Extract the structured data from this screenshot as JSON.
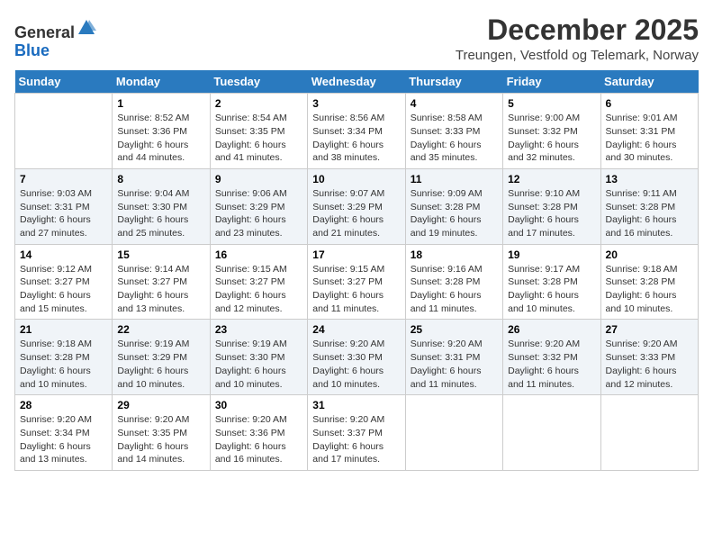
{
  "logo": {
    "general": "General",
    "blue": "Blue"
  },
  "title": "December 2025",
  "subtitle": "Treungen, Vestfold og Telemark, Norway",
  "weekdays": [
    "Sunday",
    "Monday",
    "Tuesday",
    "Wednesday",
    "Thursday",
    "Friday",
    "Saturday"
  ],
  "weeks": [
    [
      {
        "day": "",
        "info": ""
      },
      {
        "day": "1",
        "info": "Sunrise: 8:52 AM\nSunset: 3:36 PM\nDaylight: 6 hours\nand 44 minutes."
      },
      {
        "day": "2",
        "info": "Sunrise: 8:54 AM\nSunset: 3:35 PM\nDaylight: 6 hours\nand 41 minutes."
      },
      {
        "day": "3",
        "info": "Sunrise: 8:56 AM\nSunset: 3:34 PM\nDaylight: 6 hours\nand 38 minutes."
      },
      {
        "day": "4",
        "info": "Sunrise: 8:58 AM\nSunset: 3:33 PM\nDaylight: 6 hours\nand 35 minutes."
      },
      {
        "day": "5",
        "info": "Sunrise: 9:00 AM\nSunset: 3:32 PM\nDaylight: 6 hours\nand 32 minutes."
      },
      {
        "day": "6",
        "info": "Sunrise: 9:01 AM\nSunset: 3:31 PM\nDaylight: 6 hours\nand 30 minutes."
      }
    ],
    [
      {
        "day": "7",
        "info": "Sunrise: 9:03 AM\nSunset: 3:31 PM\nDaylight: 6 hours\nand 27 minutes."
      },
      {
        "day": "8",
        "info": "Sunrise: 9:04 AM\nSunset: 3:30 PM\nDaylight: 6 hours\nand 25 minutes."
      },
      {
        "day": "9",
        "info": "Sunrise: 9:06 AM\nSunset: 3:29 PM\nDaylight: 6 hours\nand 23 minutes."
      },
      {
        "day": "10",
        "info": "Sunrise: 9:07 AM\nSunset: 3:29 PM\nDaylight: 6 hours\nand 21 minutes."
      },
      {
        "day": "11",
        "info": "Sunrise: 9:09 AM\nSunset: 3:28 PM\nDaylight: 6 hours\nand 19 minutes."
      },
      {
        "day": "12",
        "info": "Sunrise: 9:10 AM\nSunset: 3:28 PM\nDaylight: 6 hours\nand 17 minutes."
      },
      {
        "day": "13",
        "info": "Sunrise: 9:11 AM\nSunset: 3:28 PM\nDaylight: 6 hours\nand 16 minutes."
      }
    ],
    [
      {
        "day": "14",
        "info": "Sunrise: 9:12 AM\nSunset: 3:27 PM\nDaylight: 6 hours\nand 15 minutes."
      },
      {
        "day": "15",
        "info": "Sunrise: 9:14 AM\nSunset: 3:27 PM\nDaylight: 6 hours\nand 13 minutes."
      },
      {
        "day": "16",
        "info": "Sunrise: 9:15 AM\nSunset: 3:27 PM\nDaylight: 6 hours\nand 12 minutes."
      },
      {
        "day": "17",
        "info": "Sunrise: 9:15 AM\nSunset: 3:27 PM\nDaylight: 6 hours\nand 11 minutes."
      },
      {
        "day": "18",
        "info": "Sunrise: 9:16 AM\nSunset: 3:28 PM\nDaylight: 6 hours\nand 11 minutes."
      },
      {
        "day": "19",
        "info": "Sunrise: 9:17 AM\nSunset: 3:28 PM\nDaylight: 6 hours\nand 10 minutes."
      },
      {
        "day": "20",
        "info": "Sunrise: 9:18 AM\nSunset: 3:28 PM\nDaylight: 6 hours\nand 10 minutes."
      }
    ],
    [
      {
        "day": "21",
        "info": "Sunrise: 9:18 AM\nSunset: 3:28 PM\nDaylight: 6 hours\nand 10 minutes."
      },
      {
        "day": "22",
        "info": "Sunrise: 9:19 AM\nSunset: 3:29 PM\nDaylight: 6 hours\nand 10 minutes."
      },
      {
        "day": "23",
        "info": "Sunrise: 9:19 AM\nSunset: 3:30 PM\nDaylight: 6 hours\nand 10 minutes."
      },
      {
        "day": "24",
        "info": "Sunrise: 9:20 AM\nSunset: 3:30 PM\nDaylight: 6 hours\nand 10 minutes."
      },
      {
        "day": "25",
        "info": "Sunrise: 9:20 AM\nSunset: 3:31 PM\nDaylight: 6 hours\nand 11 minutes."
      },
      {
        "day": "26",
        "info": "Sunrise: 9:20 AM\nSunset: 3:32 PM\nDaylight: 6 hours\nand 11 minutes."
      },
      {
        "day": "27",
        "info": "Sunrise: 9:20 AM\nSunset: 3:33 PM\nDaylight: 6 hours\nand 12 minutes."
      }
    ],
    [
      {
        "day": "28",
        "info": "Sunrise: 9:20 AM\nSunset: 3:34 PM\nDaylight: 6 hours\nand 13 minutes."
      },
      {
        "day": "29",
        "info": "Sunrise: 9:20 AM\nSunset: 3:35 PM\nDaylight: 6 hours\nand 14 minutes."
      },
      {
        "day": "30",
        "info": "Sunrise: 9:20 AM\nSunset: 3:36 PM\nDaylight: 6 hours\nand 16 minutes."
      },
      {
        "day": "31",
        "info": "Sunrise: 9:20 AM\nSunset: 3:37 PM\nDaylight: 6 hours\nand 17 minutes."
      },
      {
        "day": "",
        "info": ""
      },
      {
        "day": "",
        "info": ""
      },
      {
        "day": "",
        "info": ""
      }
    ]
  ]
}
